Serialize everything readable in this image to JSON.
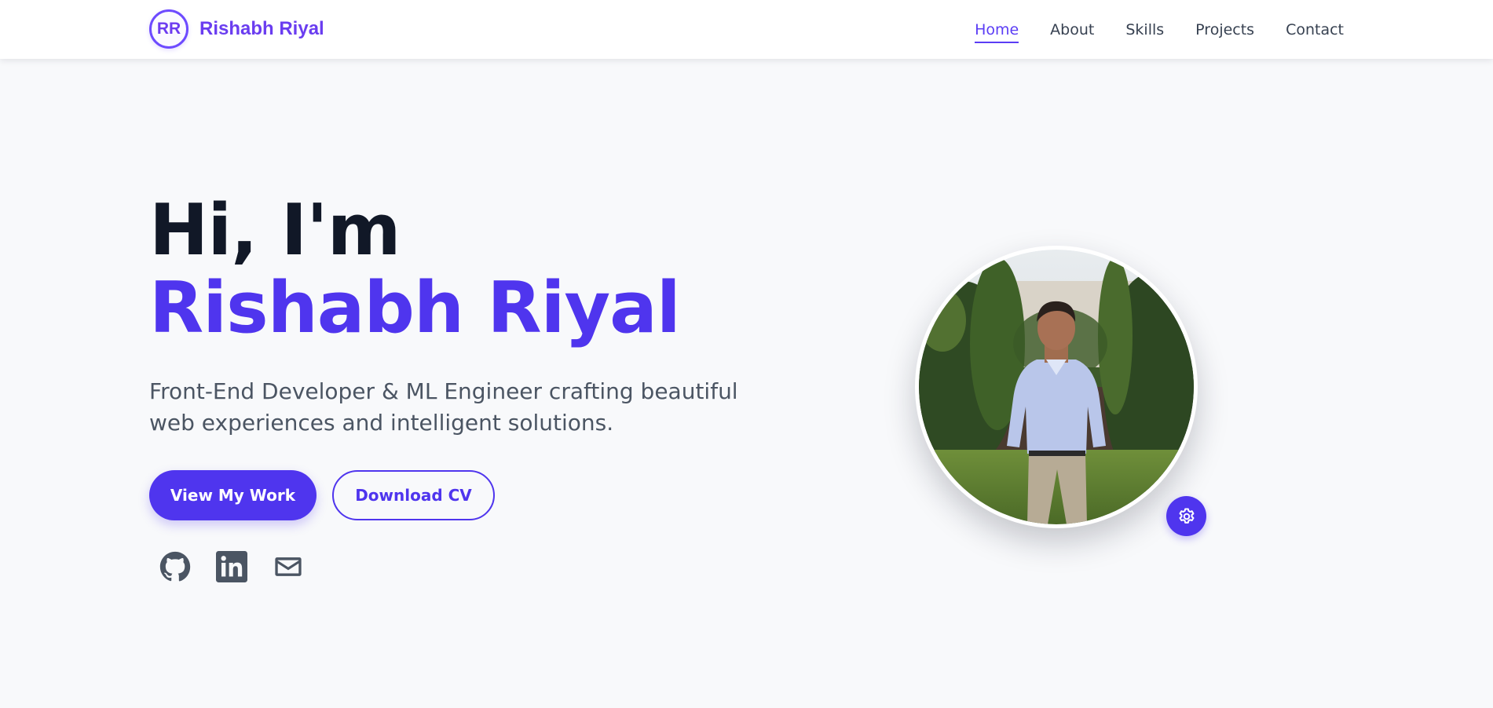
{
  "brand": {
    "initials": "RR",
    "name": "Rishabh Riyal"
  },
  "nav": {
    "items": [
      {
        "label": "Home",
        "active": true
      },
      {
        "label": "About",
        "active": false
      },
      {
        "label": "Skills",
        "active": false
      },
      {
        "label": "Projects",
        "active": false
      },
      {
        "label": "Contact",
        "active": false
      }
    ]
  },
  "hero": {
    "greeting": "Hi, I'm",
    "name": "Rishabh Riyal",
    "tagline_line1": "Front-End Developer & ML Engineer crafting beautiful",
    "tagline_line2": "web experiences and intelligent solutions.",
    "primary_button": "View My Work",
    "secondary_button": "Download CV"
  },
  "socials": [
    "github-icon",
    "linkedin-icon",
    "mail-icon"
  ],
  "photo": {
    "icon": "profile-photo"
  },
  "gear": {
    "icon": "gear-icon"
  },
  "colors": {
    "accent": "#4f35ee",
    "brand": "#6a3df0",
    "text_dark": "#111827",
    "text_muted": "#4b5563",
    "background": "#f8f9fb",
    "icon_gray": "#4b5563"
  }
}
